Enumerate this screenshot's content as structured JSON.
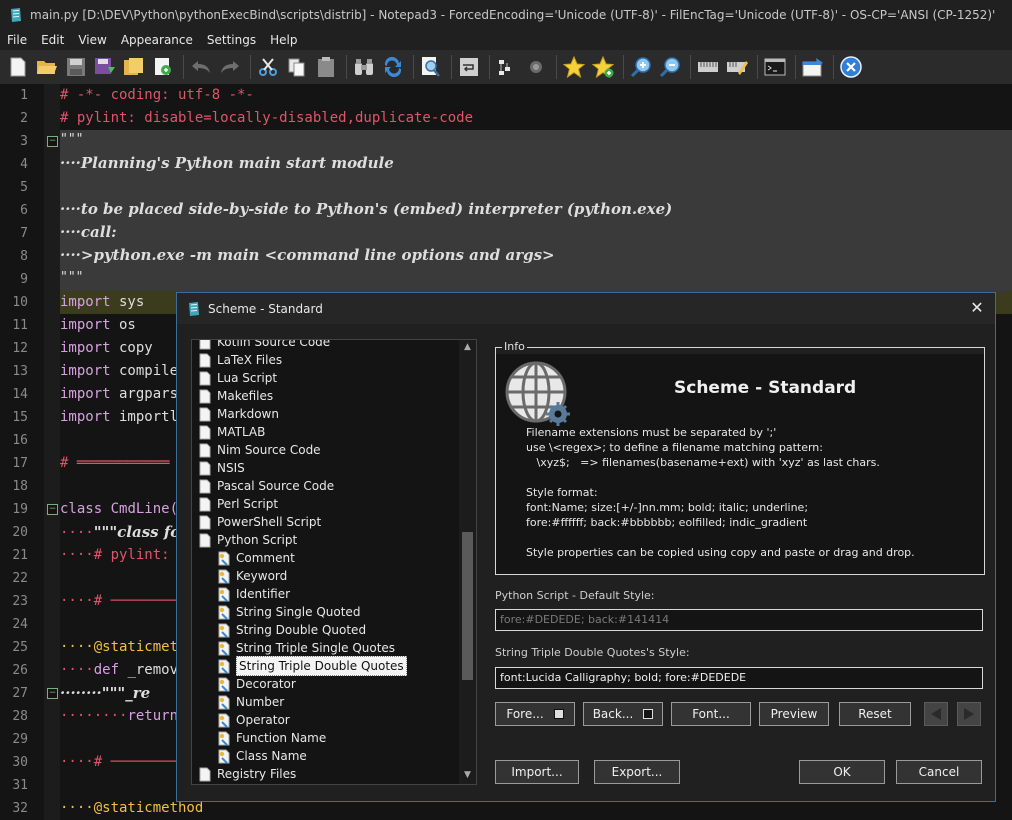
{
  "window": {
    "title": "main.py [D:\\DEV\\Python\\pythonExecBind\\scripts\\distrib] - Notepad3 - ForcedEncoding='Unicode (UTF-8)' - FilEncTag='Unicode (UTF-8)' - OS-CP='ANSI (CP-1252)'"
  },
  "menu": [
    "File",
    "Edit",
    "View",
    "Appearance",
    "Settings",
    "Help"
  ],
  "editor": {
    "line_numbers": [
      "1",
      "2",
      "3",
      "4",
      "5",
      "6",
      "7",
      "8",
      "9",
      "10",
      "11",
      "12",
      "13",
      "14",
      "15",
      "16",
      "17",
      "18",
      "19",
      "20",
      "21",
      "22",
      "23",
      "24",
      "25",
      "26",
      "27",
      "28",
      "29",
      "30",
      "31",
      "32"
    ],
    "lines": {
      "l1": "# -*- coding: utf-8 -*-",
      "l2": "# pylint: disable=locally-disabled,duplicate-code",
      "l3": "\"\"\"",
      "l4": "····Planning's Python main start module",
      "l6": "····to be placed side-by-side to Python's (embed) interpreter (python.exe)",
      "l7": "····call:",
      "l8": "····>python.exe -m main <command line options and args>",
      "l9": "\"\"\"",
      "l10_kw": "import",
      "l10_id": " sys",
      "l11_kw": "import",
      "l11_id": " os",
      "l12_kw": "import",
      "l12_id": " copy",
      "l13_kw": "import",
      "l13_id": " compile",
      "l14_kw": "import",
      "l14_id": " argpars",
      "l15_kw": "import",
      "l15_id": " importl",
      "l17": "# ═══════════",
      "l19_kw": "class",
      "l19_id": " CmdLine(",
      "l20_dots": "····",
      "l20_doc": "\"\"\"class fo",
      "l21": "····# pylint: d",
      "l23": "····# ──────────",
      "l25": "····@staticmet",
      "l26_dots": "····",
      "l26_kw": "def",
      "l26_id": " _remov",
      "l27": "········\"\"\"_re",
      "l28_dots": "········",
      "l28_kw": "return",
      "l30": "····# ──────────",
      "l32": "····@staticmethod"
    }
  },
  "dialog": {
    "title": "Scheme - Standard",
    "tree_items": [
      {
        "label": "Kotlin Source Code",
        "level": 0
      },
      {
        "label": "LaTeX Files",
        "level": 0
      },
      {
        "label": "Lua Script",
        "level": 0
      },
      {
        "label": "Makefiles",
        "level": 0
      },
      {
        "label": "Markdown",
        "level": 0
      },
      {
        "label": "MATLAB",
        "level": 0
      },
      {
        "label": "Nim Source Code",
        "level": 0
      },
      {
        "label": "NSIS",
        "level": 0
      },
      {
        "label": "Pascal Source Code",
        "level": 0
      },
      {
        "label": "Perl Script",
        "level": 0
      },
      {
        "label": "PowerShell Script",
        "level": 0
      },
      {
        "label": "Python Script",
        "level": 0
      },
      {
        "label": "Comment",
        "level": 1
      },
      {
        "label": "Keyword",
        "level": 1
      },
      {
        "label": "Identifier",
        "level": 1
      },
      {
        "label": "String Single Quoted",
        "level": 1
      },
      {
        "label": "String Double Quoted",
        "level": 1
      },
      {
        "label": "String Triple Single Quotes",
        "level": 1
      },
      {
        "label": "String Triple Double Quotes",
        "level": 1
      },
      {
        "label": "Decorator",
        "level": 1
      },
      {
        "label": "Number",
        "level": 1
      },
      {
        "label": "Operator",
        "level": 1
      },
      {
        "label": "Function Name",
        "level": 1
      },
      {
        "label": "Class Name",
        "level": 1
      },
      {
        "label": "Registry Files",
        "level": 0
      }
    ],
    "info": {
      "legend": "Info",
      "heading": "Scheme - Standard",
      "lines": [
        "Filename extensions must be separated by ';'",
        "use \\<regex>; to define a filename matching pattern:",
        "   \\xyz$;   => filenames(basename+ext) with 'xyz' as last chars.",
        "",
        "Style format:",
        "font:Name; size:[+/-]nn.mm; bold; italic; underline;",
        "fore:#ffffff; back:#bbbbbb; eolfilled; indic_gradient",
        "",
        "Style properties can be copied using copy and paste or drag and drop."
      ]
    },
    "default_style_label": "Python Script - Default Style:",
    "default_style_value": "fore:#DEDEDE; back:#141414",
    "current_style_label": "String Triple Double Quotes's  Style:",
    "current_style_value": "font:Lucida Calligraphy; bold; fore:#DEDEDE",
    "buttons": {
      "fore": "Fore...",
      "back": "Back...",
      "font": "Font...",
      "preview": "Preview",
      "reset": "Reset",
      "import": "Import...",
      "export": "Export...",
      "ok": "OK",
      "cancel": "Cancel"
    }
  },
  "colors": {
    "background": "#141414",
    "dialog_border": "#3c6e9a",
    "comment": "#e0556a",
    "keyword": "#d7a0e0",
    "current_line": "#3b3b1e"
  }
}
